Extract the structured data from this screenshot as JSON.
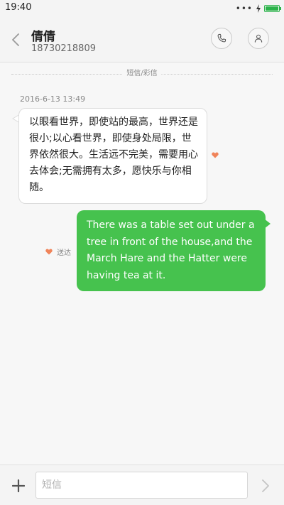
{
  "status_bar": {
    "time": "19:40",
    "signal_dots": "•••",
    "battery_color": "#2bb34a"
  },
  "header": {
    "contact_name": "倩倩",
    "contact_number": "18730218809",
    "back_icon": "chevron-left-icon",
    "call_icon": "phone-icon",
    "contact_icon": "person-icon"
  },
  "conversation": {
    "channel_label": "短信/彩信",
    "timestamp": "2016-6-13 13:49",
    "incoming_message": "以眼看世界，即使站的最高，世界还是很小;以心看世界，即使身处局限，世界依然很大。生活远不完美，需要用心去体会;无需拥有太多，愿快乐与你相随。",
    "outgoing_message": "There was a table set out under a tree in front of the house,and the March Hare and the Hatter were having tea at it.",
    "delivered_status": "送达",
    "heart_color": "#f0845a",
    "outgoing_bubble_color": "#46c24e"
  },
  "input_bar": {
    "placeholder": "短信",
    "value": "",
    "add_icon": "plus-icon",
    "send_icon": "chevron-right-icon"
  }
}
